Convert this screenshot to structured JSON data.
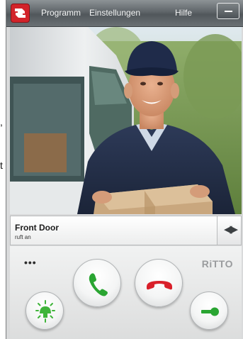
{
  "edge_text": [
    ",",
    "t"
  ],
  "window": {
    "menu": {
      "items": [
        "Programm",
        "Einstellungen",
        "Hilfe"
      ]
    },
    "caller": {
      "name": "Front Door",
      "status": "ruft an"
    },
    "controls": {
      "more": "•••",
      "brand": "RiTTO",
      "switch_icon": "◀▶"
    }
  },
  "colors": {
    "accept": "#2aa532",
    "decline": "#d9202a",
    "light": "#3fb43a",
    "door": "#2aa532",
    "logo": "#d2232a"
  },
  "icons": [
    "app-logo-icon",
    "minimize-icon",
    "switch-camera-icon",
    "light-icon",
    "accept-call-icon",
    "decline-call-icon",
    "door-opener-icon"
  ]
}
